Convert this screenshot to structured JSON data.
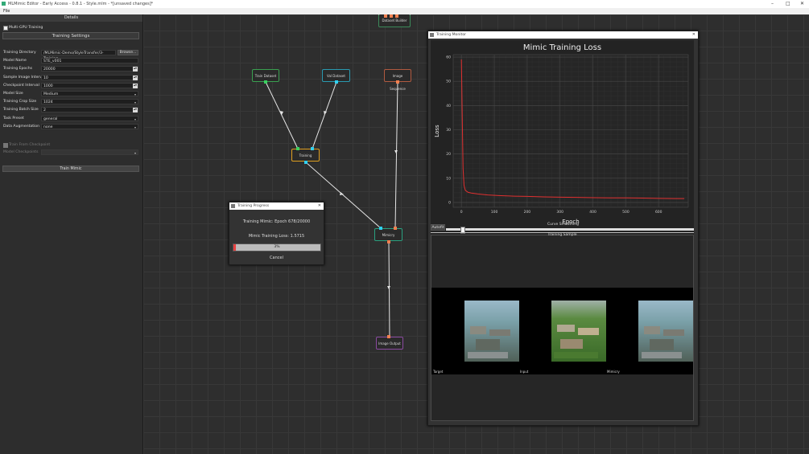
{
  "window": {
    "title": "MLMimic Editor - Early Access - 0.8.1 - Style.mlm - *[unsaved changes]*",
    "controls": [
      "–",
      "□",
      "✕"
    ]
  },
  "menu": {
    "file": "File"
  },
  "details": {
    "header": "Details",
    "multi_gpu": "Multi-GPU Training",
    "section_title": "Training Settings",
    "fields": [
      {
        "label": "Training Directory",
        "value": "/MLMimic-Demo/StyleTransfer/3-Training",
        "kind": "browse"
      },
      {
        "label": "Model Name",
        "value": "STE_v001",
        "kind": "text"
      },
      {
        "label": "Training Epochs",
        "value": "20000",
        "kind": "spin"
      },
      {
        "label": "Sample Image Interval",
        "value": "10",
        "kind": "spin"
      },
      {
        "label": "Checkpoint Interval",
        "value": "1000",
        "kind": "spin"
      },
      {
        "label": "Model Size",
        "value": "Medium",
        "kind": "dropdown"
      },
      {
        "label": "Training Crop Size",
        "value": "1024",
        "kind": "dropdown"
      },
      {
        "label": "Training Batch Size",
        "value": "2",
        "kind": "spin"
      },
      {
        "label": "Task Preset",
        "value": "general",
        "kind": "dropdown"
      },
      {
        "label": "Data Augmentation",
        "value": "none",
        "kind": "dropdown"
      }
    ],
    "browse_label": "Browse...",
    "train_from_checkpoint": "Train From Checkpoint",
    "model_checkpoints": "Model Checkpoints",
    "train_button": "Train Mimic"
  },
  "nodes": {
    "dataset_builder": "Dataset Builder",
    "train_dataset": "Train Dataset",
    "val_dataset": "Val Dataset",
    "image_sequence": "Image Sequence",
    "training": "Training",
    "mimicry": "Mimicry",
    "image_output": "Image Output"
  },
  "progress_dialog": {
    "title": "Training Progress",
    "status": "Training Mimic: Epoch 678/20000",
    "loss": "Mimic Training Loss: 1.5715",
    "percent_label": "3%",
    "progress": 0.03,
    "cancel": "Cancel"
  },
  "monitor": {
    "title": "Training Monitor",
    "autofit": "Autofit",
    "smoothing_label": "Curve Smoothing",
    "smoothing": 0.06,
    "sample_title": "Training Sample",
    "sample_labels": [
      "Target",
      "Input",
      "Mimicry"
    ]
  },
  "chart_data": {
    "type": "line",
    "title": "Mimic Training Loss",
    "xlabel": "Epoch",
    "ylabel": "Loss",
    "xlim": [
      -25,
      690
    ],
    "ylim": [
      -2,
      61
    ],
    "xticks": [
      0,
      100,
      200,
      300,
      400,
      500,
      600
    ],
    "yticks": [
      0,
      10,
      20,
      30,
      40,
      50,
      60
    ],
    "grid": true,
    "colors": {
      "line": "#e03030"
    },
    "x": [
      0,
      2,
      5,
      8,
      12,
      20,
      30,
      50,
      80,
      120,
      160,
      200,
      250,
      300,
      350,
      400,
      450,
      500,
      550,
      600,
      650,
      678
    ],
    "y": [
      59,
      40,
      14,
      7,
      5,
      4.2,
      3.9,
      3.5,
      3.1,
      2.8,
      2.6,
      2.5,
      2.3,
      2.2,
      2.1,
      2.0,
      1.9,
      1.9,
      1.8,
      1.7,
      1.6,
      1.6
    ]
  }
}
